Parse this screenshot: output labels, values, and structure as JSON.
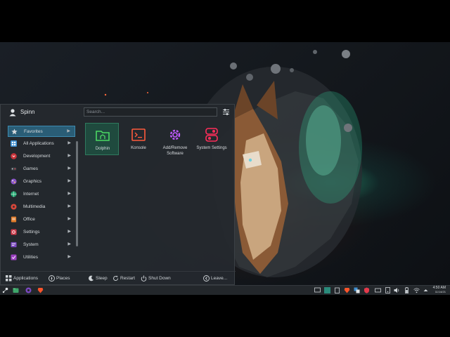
{
  "menu": {
    "username": "Spinn",
    "search": {
      "placeholder": "Search..."
    },
    "categories": [
      {
        "label": "Favorites",
        "icon": "star-icon"
      },
      {
        "label": "All Applications",
        "icon": "grid-icon"
      },
      {
        "label": "Development",
        "icon": "development-icon"
      },
      {
        "label": "Games",
        "icon": "gamepad-icon"
      },
      {
        "label": "Graphics",
        "icon": "graphics-icon"
      },
      {
        "label": "Internet",
        "icon": "globe-icon"
      },
      {
        "label": "Multimedia",
        "icon": "multimedia-icon"
      },
      {
        "label": "Office",
        "icon": "office-icon"
      },
      {
        "label": "Settings",
        "icon": "settings-icon"
      },
      {
        "label": "System",
        "icon": "system-icon"
      },
      {
        "label": "Utilities",
        "icon": "utilities-icon"
      }
    ],
    "apps": [
      {
        "name": "Dolphin",
        "icon": "folder-icon"
      },
      {
        "name": "Konsole",
        "icon": "terminal-icon"
      },
      {
        "name": "Add/Remove Software",
        "icon": "software-icon"
      },
      {
        "name": "System Settings",
        "icon": "system-settings-icon"
      }
    ],
    "footer": {
      "applications": "Applications",
      "places": "Places",
      "sleep": "Sleep",
      "restart": "Restart",
      "shutdown": "Shut Down",
      "leave": "Leave..."
    }
  },
  "taskbar": {
    "time": "4:50 AM",
    "date": "11/14/21"
  },
  "colors": {
    "accent": "#2a5d76",
    "app_highlight": "#1f4a3e",
    "panel": "#24292e",
    "taskbar": "#23272b"
  }
}
